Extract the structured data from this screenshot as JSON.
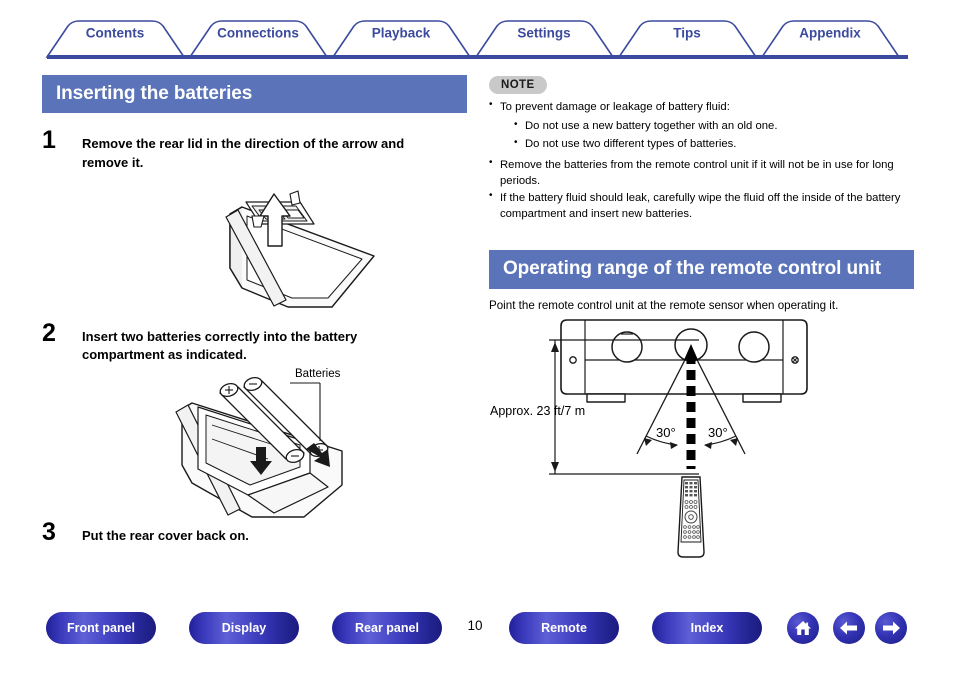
{
  "header": {
    "tabs": [
      {
        "label": "Contents"
      },
      {
        "label": "Connections"
      },
      {
        "label": "Playback"
      },
      {
        "label": "Settings"
      },
      {
        "label": "Tips"
      },
      {
        "label": "Appendix"
      }
    ],
    "accent_color": "#3b4a9e"
  },
  "left_column": {
    "section_title": "Inserting the batteries",
    "steps": [
      {
        "number": "1",
        "text": "Remove the rear lid in the direction of the arrow and remove it."
      },
      {
        "number": "2",
        "text": "Insert two batteries correctly into the battery compartment as indicated."
      },
      {
        "number": "3",
        "text": "Put the rear cover back on."
      }
    ],
    "figure_labels": {
      "batteries": "Batteries"
    }
  },
  "right_column": {
    "note": {
      "badge": "NOTE",
      "items": [
        {
          "text": "To prevent damage or leakage of battery fluid:",
          "subitems": [
            "Do not use a new battery together with an old one.",
            "Do not use two different types of batteries."
          ]
        },
        {
          "text": "Remove the batteries from the remote control unit if it will not be in use for long periods.",
          "subitems": []
        },
        {
          "text": "If the battery fluid should leak, carefully wipe the fluid off the inside of the battery compartment and insert new batteries.",
          "subitems": []
        }
      ]
    },
    "section_title": "Operating range of the remote control unit",
    "intro_text": "Point the remote control unit at the remote sensor when operating it.",
    "diagram": {
      "distance_label": "Approx. 23 ft/7 m",
      "angle_left": "30°",
      "angle_right": "30°"
    }
  },
  "footer": {
    "page_number": "10",
    "buttons": [
      {
        "label": "Front panel"
      },
      {
        "label": "Display"
      },
      {
        "label": "Rear panel"
      },
      {
        "label": "Remote"
      },
      {
        "label": "Index"
      }
    ],
    "icon_buttons": [
      {
        "name": "home-icon"
      },
      {
        "name": "back-arrow-icon"
      },
      {
        "name": "forward-arrow-icon"
      }
    ],
    "button_color": "#2a2aa5"
  }
}
